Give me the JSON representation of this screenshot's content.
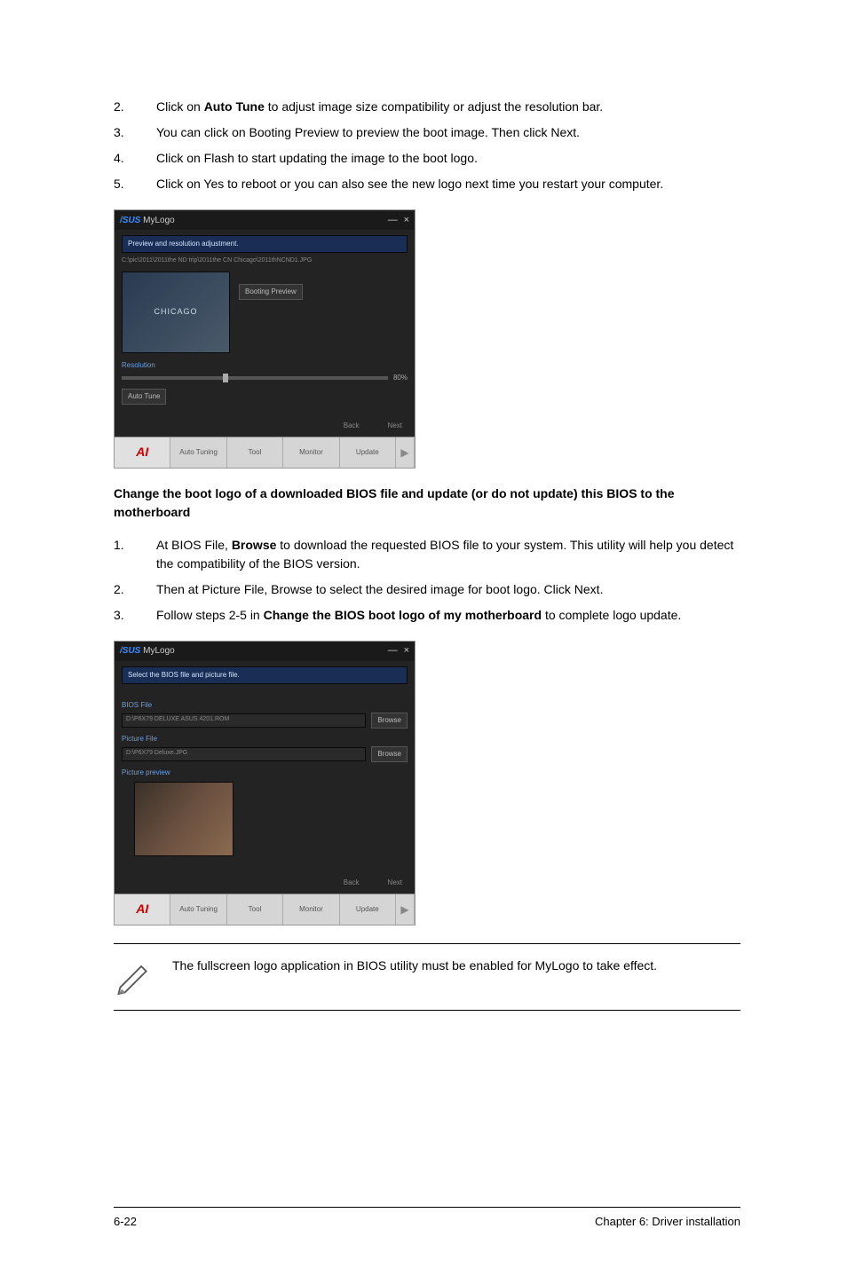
{
  "steps_top": [
    {
      "num": "2.",
      "prefix": "Click on ",
      "bold": "Auto Tune",
      "suffix": " to adjust image size compatibility or adjust the resolution bar."
    },
    {
      "num": "3.",
      "prefix": "You can click on Booting Preview to preview the boot image. Then click Next.",
      "bold": "",
      "suffix": ""
    },
    {
      "num": "4.",
      "prefix": "Click on Flash to start updating the image to the boot logo.",
      "bold": "",
      "suffix": ""
    },
    {
      "num": "5.",
      "prefix": "Click on Yes to reboot or you can also see the new logo next time you restart your computer.",
      "bold": "",
      "suffix": ""
    }
  ],
  "screenshot1": {
    "title": "MyLogo",
    "banner": "Preview and resolution adjustment.",
    "path": "C:\\pic\\2011\\2011the ND trip\\2011the CN Chicago\\2011thNCND1.JPG",
    "preview_text": "CHICAGO",
    "booting_preview": "Booting Preview",
    "resolution_label": "Resolution",
    "slider_value": "80%",
    "auto_tune": "Auto Tune",
    "back": "Back",
    "next": "Next",
    "tabs": [
      "Auto Tuning",
      "Tool",
      "Monitor",
      "Update"
    ]
  },
  "section_title": "Change the boot logo of a downloaded BIOS file and update (or do not update) this BIOS to the motherboard",
  "steps_bottom": [
    {
      "num": "1.",
      "prefix": "At BIOS File, ",
      "bold": "Browse",
      "suffix": " to download the requested BIOS file to your system. This utility will help you detect the compatibility of the BIOS version."
    },
    {
      "num": "2.",
      "prefix": "Then at Picture File, Browse to select the desired image for boot logo. Click Next.",
      "bold": "",
      "suffix": ""
    },
    {
      "num": "3.",
      "prefix": "Follow steps 2-5 in ",
      "bold": "Change the BIOS boot logo of my motherboard",
      "suffix": " to complete logo update."
    }
  ],
  "screenshot2": {
    "title": "MyLogo",
    "banner": "Select the BIOS file and picture file.",
    "bios_label": "BIOS File",
    "bios_value": "D:\\P6X79 DELUXE ASUS 4201.ROM",
    "bios_browse": "Browse",
    "pic_label": "Picture File",
    "pic_value": "D:\\P6X79 Deluxe.JPG",
    "pic_browse": "Browse",
    "preview_label": "Picture preview",
    "back": "Back",
    "next": "Next",
    "tabs": [
      "Auto Tuning",
      "Tool",
      "Monitor",
      "Update"
    ]
  },
  "note": "The fullscreen logo application in BIOS utility must be enabled for MyLogo to take effect.",
  "footer_left": "6-22",
  "footer_right": "Chapter 6: Driver installation"
}
